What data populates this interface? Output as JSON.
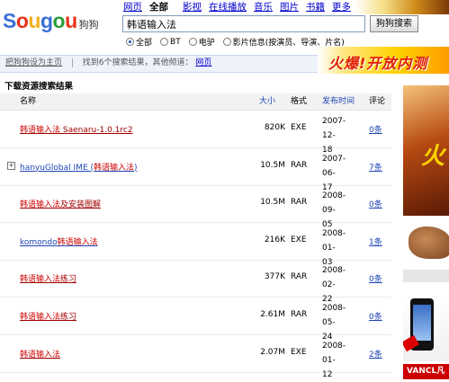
{
  "logo": {
    "text": "ougou",
    "letter_s": "S",
    "cn": "狗狗",
    "colors": [
      "#3b6fd8",
      "#e8331b",
      "#f2b01e",
      "#3b6fd8",
      "#2a9d3a",
      "#e8331b"
    ]
  },
  "nav": {
    "items": [
      "网页",
      "全部",
      "影视",
      "在线播放",
      "音乐",
      "图片",
      "书籍",
      "更多"
    ],
    "current": "全部"
  },
  "search": {
    "value": "韩语输入法",
    "button": "狗狗搜索"
  },
  "radios": [
    {
      "label": "全部",
      "checked": true
    },
    {
      "label": "BT",
      "checked": false
    },
    {
      "label": "电驴",
      "checked": false
    },
    {
      "label": "影片信息(按演员、导演、片名)",
      "checked": false
    }
  ],
  "promo": {
    "text": "火爆!开放内测"
  },
  "infobar": {
    "sethome": "把狗狗设为主页",
    "found": "找到6个搜索结果，其他频道：",
    "channel": "网页"
  },
  "section_title": "下载资源搜索结果",
  "table": {
    "headers": {
      "name": "名称",
      "size": "大小",
      "format": "格式",
      "date": "发布时间",
      "comments": "评论"
    },
    "rows": [
      {
        "name_hl": "韩语输入法",
        "name_rest": " Saenaru-1.0.1rc2",
        "size": "820K",
        "format": "EXE",
        "date1": "2007-12-",
        "date2": "18",
        "comments": "0条",
        "expand": false,
        "blue": false
      },
      {
        "name_pre": "hanyuGlobal IME (",
        "name_hl": "韩语输入法",
        "name_rest": ")",
        "size": "10.5M",
        "format": "RAR",
        "date1": "2007-06-",
        "date2": "17",
        "comments": "7条",
        "expand": true,
        "blue": true
      },
      {
        "name_hl": "韩语输入法",
        "name_rest": "及安装图解",
        "size": "10.5M",
        "format": "RAR",
        "date1": "2008-09-",
        "date2": "05",
        "comments": "0条",
        "expand": false,
        "blue": false
      },
      {
        "name_pre": "komondo",
        "name_hl": "韩语输入法",
        "name_rest": "",
        "size": "216K",
        "format": "EXE",
        "date1": "2008-01-",
        "date2": "03",
        "comments": "1条",
        "expand": false,
        "blue": true
      },
      {
        "name_hl": "韩语输入法",
        "name_rest": "练习",
        "size": "377K",
        "format": "RAR",
        "date1": "2008-02-",
        "date2": "22",
        "comments": "0条",
        "expand": false,
        "blue": false
      },
      {
        "name_hl": "韩语输入法",
        "name_rest": "练习",
        "size": "2.61M",
        "format": "RAR",
        "date1": "2008-05-",
        "date2": "24",
        "comments": "0条",
        "expand": false,
        "blue": false
      },
      {
        "name_hl": "韩语输入法",
        "name_rest": "",
        "size": "2.07M",
        "format": "EXE",
        "date1": "2008-01-",
        "date2": "12",
        "comments": "2条",
        "expand": false,
        "blue": false
      }
    ]
  },
  "ads": {
    "ad1_text": "火",
    "ad4_text": "VANCL凡客"
  }
}
